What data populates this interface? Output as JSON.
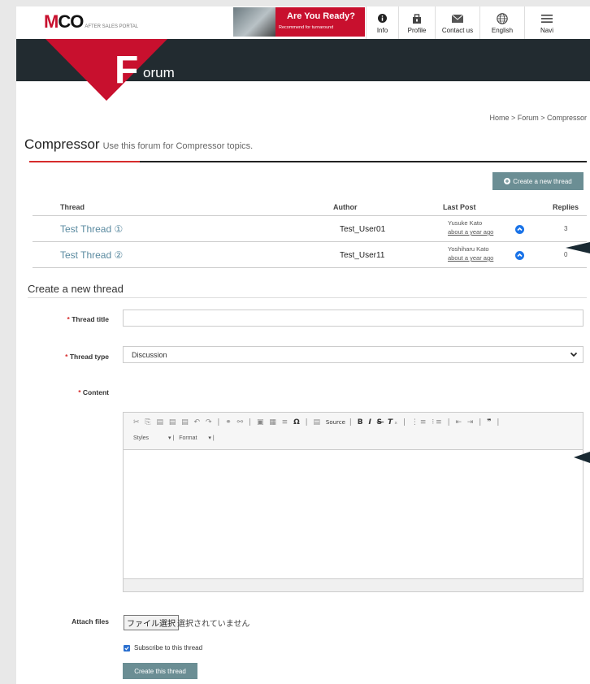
{
  "header": {
    "logo_main": "MCO",
    "logo_sub": "AFTER SALES PORTAL",
    "banner_title": "Are You Ready?",
    "banner_sub": "Recommend for turnaround",
    "nav": [
      {
        "label": "Info",
        "icon": "info-icon"
      },
      {
        "label": "Profile",
        "icon": "profile-icon"
      },
      {
        "label": "Contact us",
        "icon": "mail-icon"
      },
      {
        "label": "English",
        "icon": "globe-icon"
      },
      {
        "label": "Navi",
        "icon": "menu-icon"
      }
    ],
    "section_letter": "F",
    "section_rest": "orum"
  },
  "breadcrumb": "Home  >  Forum  > Compressor",
  "page": {
    "title": "Compressor",
    "description": "Use this forum for Compressor topics."
  },
  "new_thread_button": "Create a new thread",
  "table": {
    "columns": [
      "Thread",
      "Author",
      "Last Post",
      "Replies"
    ],
    "rows": [
      {
        "thread": "Test  Thread ①",
        "author": "Test_User01",
        "last_user": "Yusuke Kato",
        "last_time": "about a year ago",
        "replies": "3"
      },
      {
        "thread": "Test  Thread ②",
        "author": "Test_User11",
        "last_user": "Yoshiharu Kato",
        "last_time": "about a year ago",
        "replies": "0"
      }
    ]
  },
  "form": {
    "heading": "Create a new thread",
    "title_label": "Thread title",
    "type_label": "Thread type",
    "type_value": "Discussion",
    "content_label": "Content",
    "toolbar_source": "Source",
    "toolbar_styles": "Styles",
    "toolbar_format": "Format",
    "attach_label": "Attach files",
    "attach_button": "ファイル選択",
    "attach_status": "選択されていません",
    "subscribe_label": "Subscribe to this thread",
    "subscribe_checked": true,
    "submit": "Create this thread"
  },
  "colors": {
    "brand_red": "#c8102e",
    "dark_band": "#222b30",
    "button_teal": "#6b8e94",
    "link_blue": "#5a8aa0"
  }
}
